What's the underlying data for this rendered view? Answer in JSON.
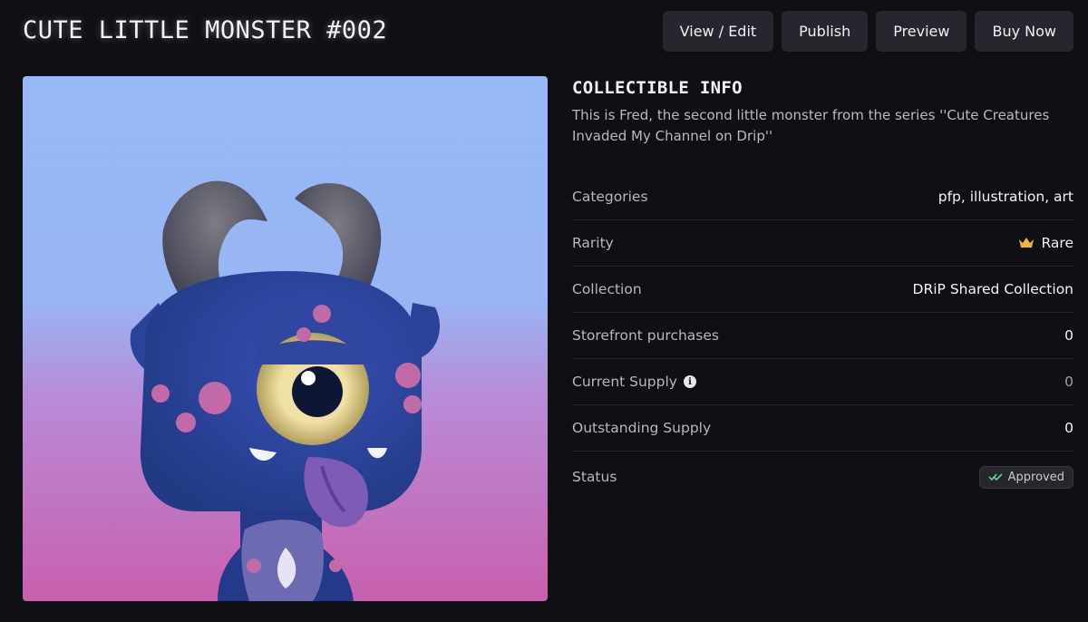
{
  "header": {
    "title": "CUTE LITTLE MONSTER #002",
    "buttons": {
      "view_edit": "View / Edit",
      "publish": "Publish",
      "preview": "Preview",
      "buy_now": "Buy Now"
    }
  },
  "artwork": {
    "gradient_top": "#96b8f5",
    "gradient_bottom": "#c85fae",
    "body_color": "#2f4aa8"
  },
  "info": {
    "heading": "COLLECTIBLE INFO",
    "description": "This is Fred, the second little monster from the series ''Cute Creatures Invaded My Channel on Drip''",
    "rows": {
      "categories": {
        "label": "Categories",
        "value": "pfp, illustration, art"
      },
      "rarity": {
        "label": "Rarity",
        "value": "Rare",
        "icon": "crown-icon",
        "icon_color": "#f2b53a"
      },
      "collection": {
        "label": "Collection",
        "value": "DRiP Shared Collection"
      },
      "storefront_purchases": {
        "label": "Storefront purchases",
        "value": "0"
      },
      "current_supply": {
        "label": "Current Supply",
        "value": "0",
        "icon": "info-icon"
      },
      "outstanding_supply": {
        "label": "Outstanding Supply",
        "value": "0"
      },
      "status": {
        "label": "Status",
        "value": "Approved",
        "icon": "double-check-icon",
        "icon_color": "#5fd38a"
      }
    }
  },
  "colors": {
    "background": "#0f1014",
    "button_bg": "#26272e",
    "divider": "#24252b"
  }
}
